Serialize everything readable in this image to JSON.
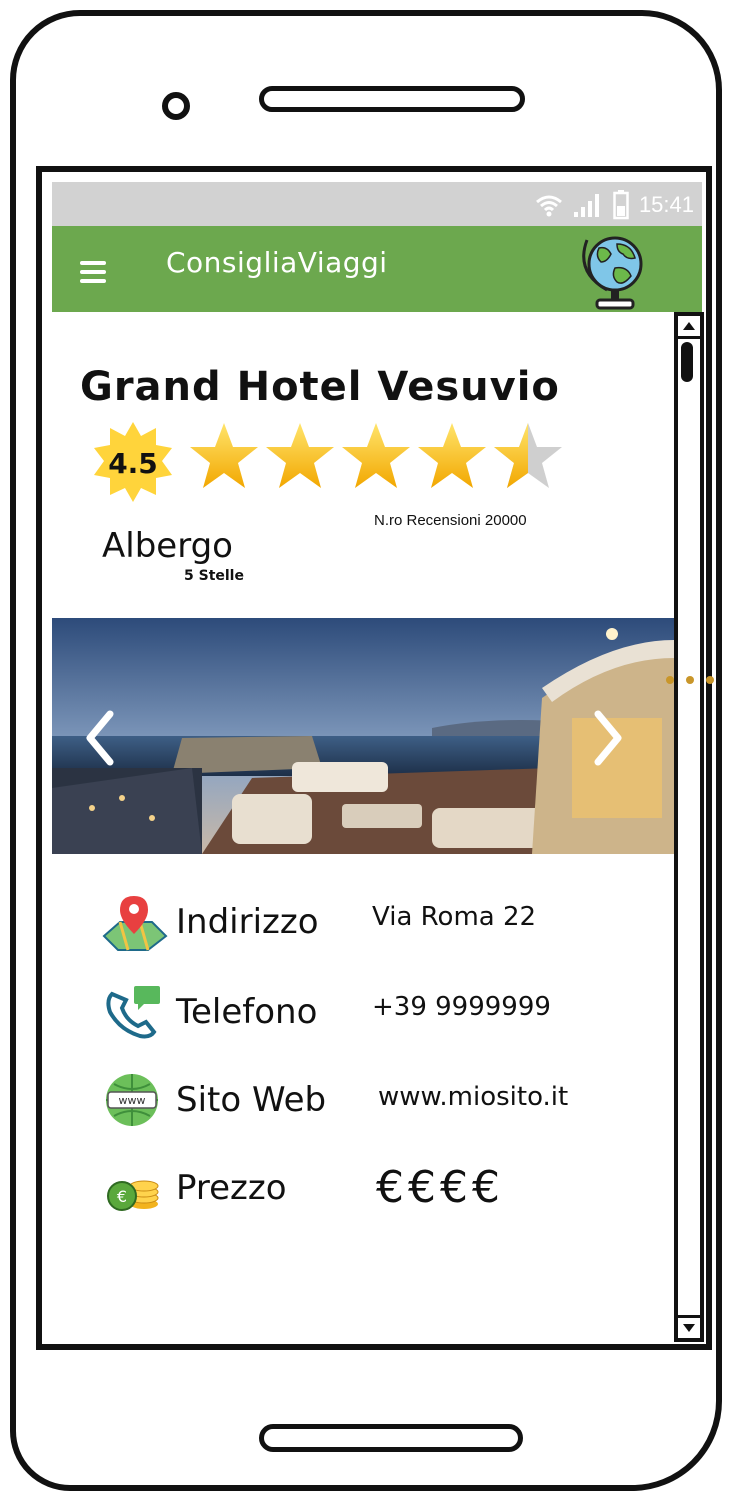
{
  "status_bar": {
    "time": "15:41",
    "icons": [
      "wifi-icon",
      "signal-icon",
      "battery-icon"
    ]
  },
  "app_bar": {
    "title": "ConsigliaViaggi",
    "menu_icon": "menu-icon",
    "logo_icon": "globe-icon",
    "color": "#6ca84e"
  },
  "hotel": {
    "name": "Grand Hotel Vesuvio",
    "rating": "4.5",
    "rating_value": 4.5,
    "rating_max": 5,
    "reviews": "N.ro Recensioni 20000",
    "type": "Albergo",
    "class": "5 Stelle"
  },
  "gallery": {
    "prev_icon": "chevron-left-icon",
    "next_icon": "chevron-right-icon"
  },
  "details": [
    {
      "label": "Indirizzo",
      "value": "Via Roma 22",
      "icon": "map-pin-icon"
    },
    {
      "label": "Telefono",
      "value": "+39 9999999",
      "icon": "phone-chat-icon"
    },
    {
      "label": "Sito Web",
      "value": "www.miosito.it",
      "icon": "www-globe-icon"
    },
    {
      "label": "Prezzo",
      "value": "€€€€",
      "icon": "coins-icon"
    }
  ],
  "colors": {
    "star": "#f7b800",
    "badge": "#ffd43b",
    "status_bar": "#d2d2d2"
  }
}
